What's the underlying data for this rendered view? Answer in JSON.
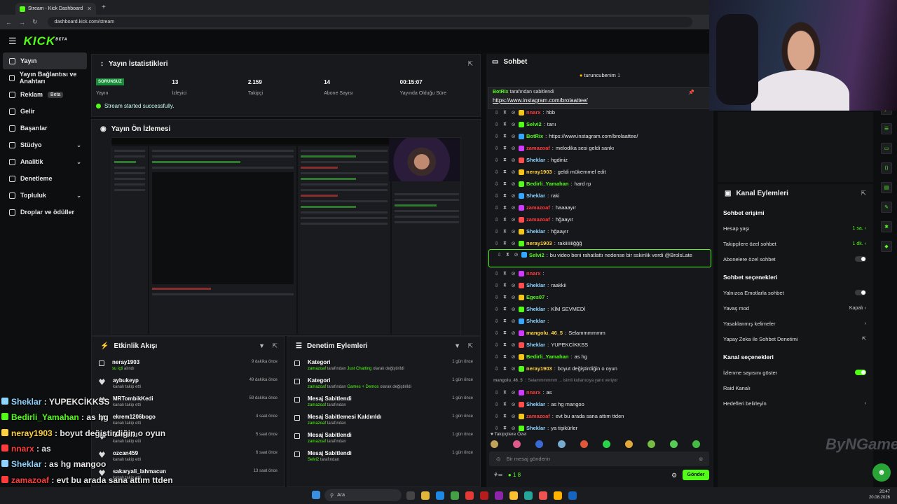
{
  "browser": {
    "tab_title": "Stream - Kick Dashboard",
    "url": "dashboard.kick.com/stream"
  },
  "brand": {
    "logo": "KICK",
    "logo_sup": "BETA",
    "accent": "#53fc18"
  },
  "sidebar": {
    "items": [
      {
        "label": "Yayın",
        "active": true
      },
      {
        "label": "Yayın Bağlantısı ve Anahtarı"
      },
      {
        "label": "Reklam",
        "badge": "Beta"
      },
      {
        "label": "Gelir"
      },
      {
        "label": "Başarılar"
      },
      {
        "label": "Stüdyo",
        "chevron": true
      },
      {
        "label": "Analitik",
        "chevron": true
      },
      {
        "label": "Denetleme"
      },
      {
        "label": "Topluluk",
        "chevron": true
      },
      {
        "label": "Droplar ve ödüller"
      }
    ]
  },
  "stats": {
    "title": "Yayın İstatistikleri",
    "status_badge": "SORUNSUZ",
    "items": [
      {
        "value": "",
        "label": "Yayın"
      },
      {
        "value": "13",
        "label": "İzleyici"
      },
      {
        "value": "2.159",
        "label": "Takipçi"
      },
      {
        "value": "14",
        "label": "Abone Sayısı"
      },
      {
        "value": "00:15:07",
        "label": "Yayında Olduğu Süre"
      }
    ],
    "success_msg": "Stream started successfully."
  },
  "preview": {
    "title": "Yayın Ön İzlemesi"
  },
  "activity": {
    "title": "Etkinlik Akışı",
    "items": [
      {
        "name": "neray1903",
        "sub": "",
        "sub_green": "su içti",
        "sub_after": " alındı",
        "time": "9 dakika önce",
        "icon": "gift"
      },
      {
        "name": "aybukeyp",
        "sub": "kanalı takip etti",
        "time": "49 dakika önce",
        "icon": "heart"
      },
      {
        "name": "MRTombikKedi",
        "sub": "kanalı takip etti",
        "time": "59 dakika önce",
        "icon": "heart"
      },
      {
        "name": "ekrem1206bogo",
        "sub": "kanalı takip etti",
        "time": "4 saat önce",
        "icon": "heart"
      },
      {
        "name": "damsaral",
        "sub": "kanalı takip etti",
        "time": "5 saat önce",
        "icon": "heart"
      },
      {
        "name": "ozcan459",
        "sub": "kanalı takip etti",
        "time": "6 saat önce",
        "icon": "heart"
      },
      {
        "name": "sakaryali_lahmacun",
        "sub": "kanalı takip etti",
        "time": "13 saat önce",
        "icon": "heart"
      }
    ]
  },
  "moderation": {
    "title": "Denetim Eylemleri",
    "items": [
      {
        "name": "Kategori",
        "who": "zamazoaf",
        "mid": " tarafından ",
        "target": "Just Chatting",
        "end": " olarak değiştirildi",
        "time": "1 gün önce"
      },
      {
        "name": "Kategori",
        "who": "zamazoaf",
        "mid": " tarafından ",
        "target": "Games + Demos",
        "end": " olarak değiştirildi",
        "time": "1 gün önce"
      },
      {
        "name": "Mesaj Sabitlendi",
        "who": "zamazoaf",
        "mid": " tarafından",
        "target": "",
        "end": "",
        "time": "1 gün önce"
      },
      {
        "name": "Mesaj Sabitlemesi Kaldırıldı",
        "who": "zamazoaf",
        "mid": " tarafından",
        "target": "",
        "end": "",
        "time": "1 gün önce"
      },
      {
        "name": "Mesaj Sabitlendi",
        "who": "zamazoaf",
        "mid": " tarafından",
        "target": "",
        "end": "",
        "time": "1 gün önce"
      },
      {
        "name": "Mesaj Sabitlendi",
        "who": "Selvi2",
        "mid": " tarafından",
        "target": "",
        "end": "",
        "time": "1 gün önce"
      }
    ]
  },
  "chat": {
    "title": "Sohbet",
    "top_user": "turuncubenim",
    "top_count": "1",
    "pinned_by": "BotRix",
    "pinned_suffix": " tarafından sabitlendi",
    "pinned_link": "https://www.instagram.com/brolaattee/",
    "messages": [
      {
        "user": "nnarx",
        "color": "#ff3b3b",
        "text": "hbb"
      },
      {
        "user": "Selvi2",
        "color": "#53fc18",
        "text": "tanı"
      },
      {
        "user": "BotRix",
        "color": "#53fc18",
        "text": "https://www.instagram.com/brolaattee/"
      },
      {
        "user": "zamazoaf",
        "color": "#ff3b3b",
        "text": "melodika sesi geldi sankı"
      },
      {
        "user": "Sheklar",
        "color": "#8fd3ff",
        "text": "hgdiniz"
      },
      {
        "user": "neray1903",
        "color": "#ffd23f",
        "text": "geldi mükemmel edit"
      },
      {
        "user": "Bedirli_Yamahan",
        "color": "#53fc18",
        "text": "hard rp"
      },
      {
        "user": "Sheklar",
        "color": "#8fd3ff",
        "text": "raki"
      },
      {
        "user": "zamazoaf",
        "color": "#ff3b3b",
        "text": "haaaayır"
      },
      {
        "user": "zamazoaf",
        "color": "#ff3b3b",
        "text": "hğaayır"
      },
      {
        "user": "Sheklar",
        "color": "#8fd3ff",
        "text": "hğaayır"
      },
      {
        "user": "neray1903",
        "color": "#ffd23f",
        "text": "rakiiiiiiiğğğ"
      },
      {
        "user": "Selvi2",
        "color": "#53fc18",
        "text": "bu video beni rahatlattı nedense bir sskinlik verdi @BrolsLate",
        "highlight": true
      },
      {
        "user": "nnarx",
        "color": "#ff3b3b",
        "text": ""
      },
      {
        "user": "Sheklar",
        "color": "#8fd3ff",
        "text": "raakkii"
      },
      {
        "user": "Eges07",
        "color": "#53fc18",
        "text": ""
      },
      {
        "user": "Sheklar",
        "color": "#8fd3ff",
        "text": "KİM SEVMEDİ"
      },
      {
        "user": "Sheklar",
        "color": "#8fd3ff",
        "text": ""
      },
      {
        "user": "mangolu_46_5",
        "color": "#ffd23f",
        "text": "Selammmmmm"
      },
      {
        "user": "Sheklar",
        "color": "#8fd3ff",
        "text": "YUPEKCİKKSS"
      },
      {
        "user": "Bedirli_Yamahan",
        "color": "#53fc18",
        "text": "as hg"
      },
      {
        "user": "neray1903",
        "color": "#ffd23f",
        "text": "boyut değiştirdiğin o oyun"
      },
      {
        "user": "mangolu_46_5",
        "color": "#888888",
        "text": "Selammmmmm ... isimli kullanıcıya yanıt veriyor",
        "reply": true
      },
      {
        "user": "nnarx",
        "color": "#ff3b3b",
        "text": "as"
      },
      {
        "user": "Sheklar",
        "color": "#8fd3ff",
        "text": "as hg mangoo"
      },
      {
        "user": "zamazoaf",
        "color": "#ff3b3b",
        "text": "evt bu arada sana attım ttden"
      },
      {
        "user": "Sheklar",
        "color": "#8fd3ff",
        "text": "ya tişikürler"
      }
    ],
    "emote_label": "Takipçilere Özel",
    "input_placeholder": "Bir mesaj gönderin",
    "points": "1 8",
    "send_label": "Gönder"
  },
  "channel": {
    "title": "Kanal Eylemleri",
    "sections": [
      {
        "head": "Sohbet erişimi",
        "rows": [
          {
            "label": "Hesap yaşı",
            "value": "1 sa.",
            "type": "value-green"
          },
          {
            "label": "Takipçilere özel sohbet",
            "value": "1 dk.",
            "type": "value-green"
          },
          {
            "label": "Abonelere özel sohbet",
            "value": "",
            "type": "toggle-off"
          }
        ]
      },
      {
        "head": "Sohbet seçenekleri",
        "rows": [
          {
            "label": "Yalnızca Emotlarla sohbet",
            "value": "",
            "type": "toggle-off"
          },
          {
            "label": "Yavaş mod",
            "value": "Kapalı",
            "type": "value"
          },
          {
            "label": "Yasaklanmış kelimeler",
            "value": "",
            "type": "chevron"
          },
          {
            "label": "Yapay Zeka ile Sohbet Denetimi",
            "value": "",
            "type": "external"
          }
        ]
      },
      {
        "head": "Kanal seçenekleri",
        "rows": [
          {
            "label": "İzlenme sayısını göster",
            "value": "",
            "type": "toggle-on"
          },
          {
            "label": "Raid Kanalı",
            "value": "",
            "type": "none"
          },
          {
            "label": "Hedefleri belirleyin",
            "value": "",
            "type": "chevron"
          }
        ]
      }
    ]
  },
  "overlay_chat": [
    {
      "user": "Sheklar",
      "color": "#8fd3ff",
      "text": "YUPEKCİKKSS"
    },
    {
      "user": "Bedirli_Yamahan",
      "color": "#53fc18",
      "text": "as hg"
    },
    {
      "user": "neray1903",
      "color": "#ffd23f",
      "text": "boyut değiştirdiğin o oyun"
    },
    {
      "user": "nnarx",
      "color": "#ff3b3b",
      "text": "as"
    },
    {
      "user": "Sheklar",
      "color": "#8fd3ff",
      "text": "as hg mangoo"
    },
    {
      "user": "zamazoaf",
      "color": "#ff3b3b",
      "text": "evt bu arada sana attım ttden"
    },
    {
      "user": "Sheklar",
      "color": "#8fd3ff",
      "text": "ya tişikürler"
    }
  ],
  "watermark": "ByNGame",
  "taskbar": {
    "search": "Ara",
    "time": "20:47",
    "date": "20.08.2026"
  }
}
